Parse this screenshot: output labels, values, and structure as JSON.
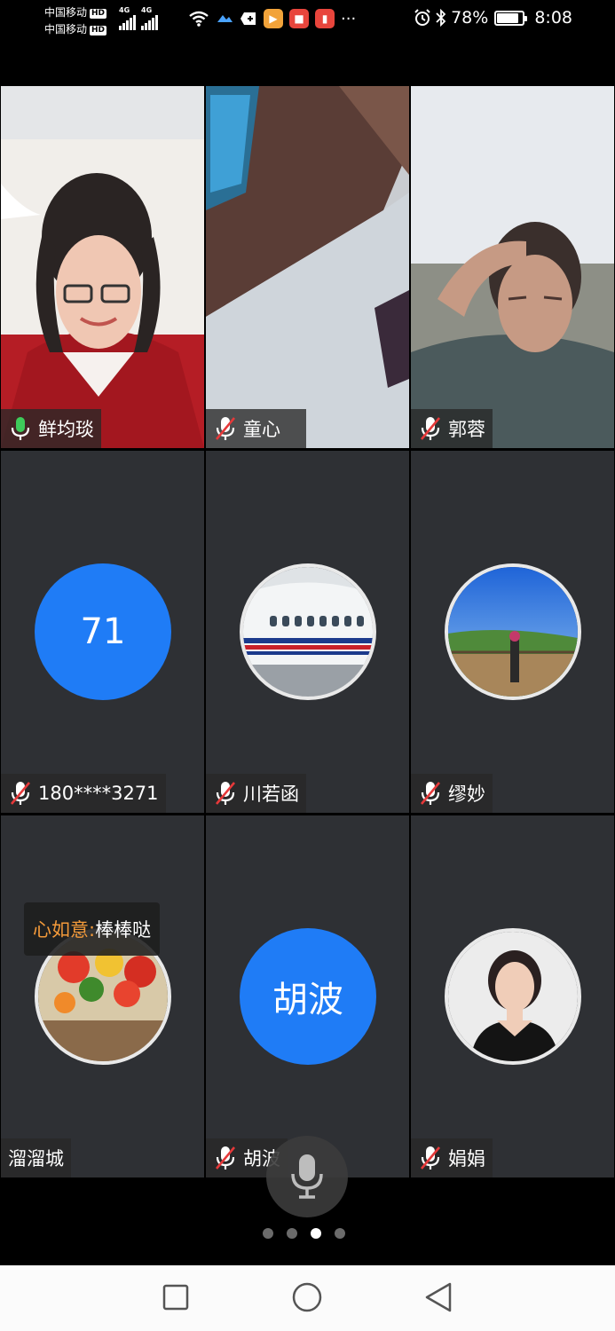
{
  "status_bar": {
    "carrier_1": "中国移动",
    "carrier_2": "中国移动",
    "hd_badge": "HD",
    "network_1": "4G",
    "network_2": "4G",
    "battery_percent": "78%",
    "battery_level": 0.78,
    "time": "8:08",
    "more": "···"
  },
  "participants": [
    {
      "name": "鲜均琰",
      "muted": false,
      "type": "video"
    },
    {
      "name": "童心 ",
      "muted": true,
      "type": "video"
    },
    {
      "name": "郭蓉",
      "muted": true,
      "type": "video"
    },
    {
      "name": "180****3271",
      "muted": true,
      "type": "initials",
      "avatar_text": "71"
    },
    {
      "name": "川若函",
      "muted": true,
      "type": "photo",
      "avatar_icon": "airplane-photo-icon"
    },
    {
      "name": "缪妙",
      "muted": true,
      "type": "photo",
      "avatar_icon": "landscape-photo-icon"
    },
    {
      "name": "溜溜城",
      "muted": null,
      "type": "photo",
      "avatar_icon": "food-photo-icon"
    },
    {
      "name": "胡波",
      "muted": true,
      "type": "initials",
      "avatar_text": "胡波"
    },
    {
      "name": "娟娟",
      "muted": true,
      "type": "photo",
      "avatar_icon": "portrait-photo-icon"
    }
  ],
  "chat_bubble": {
    "sender": "心如意: ",
    "message": "棒棒哒"
  },
  "pager": {
    "pages": 4,
    "current": 3
  },
  "colors": {
    "avatar_blue": "#1f7cf6",
    "mic_green": "#3ecb5a",
    "mic_muted_red": "#e6393a",
    "chat_sender": "#f39a3a"
  },
  "nav": {
    "icons": [
      "recents-square-icon",
      "home-circle-icon",
      "back-triangle-icon"
    ]
  }
}
